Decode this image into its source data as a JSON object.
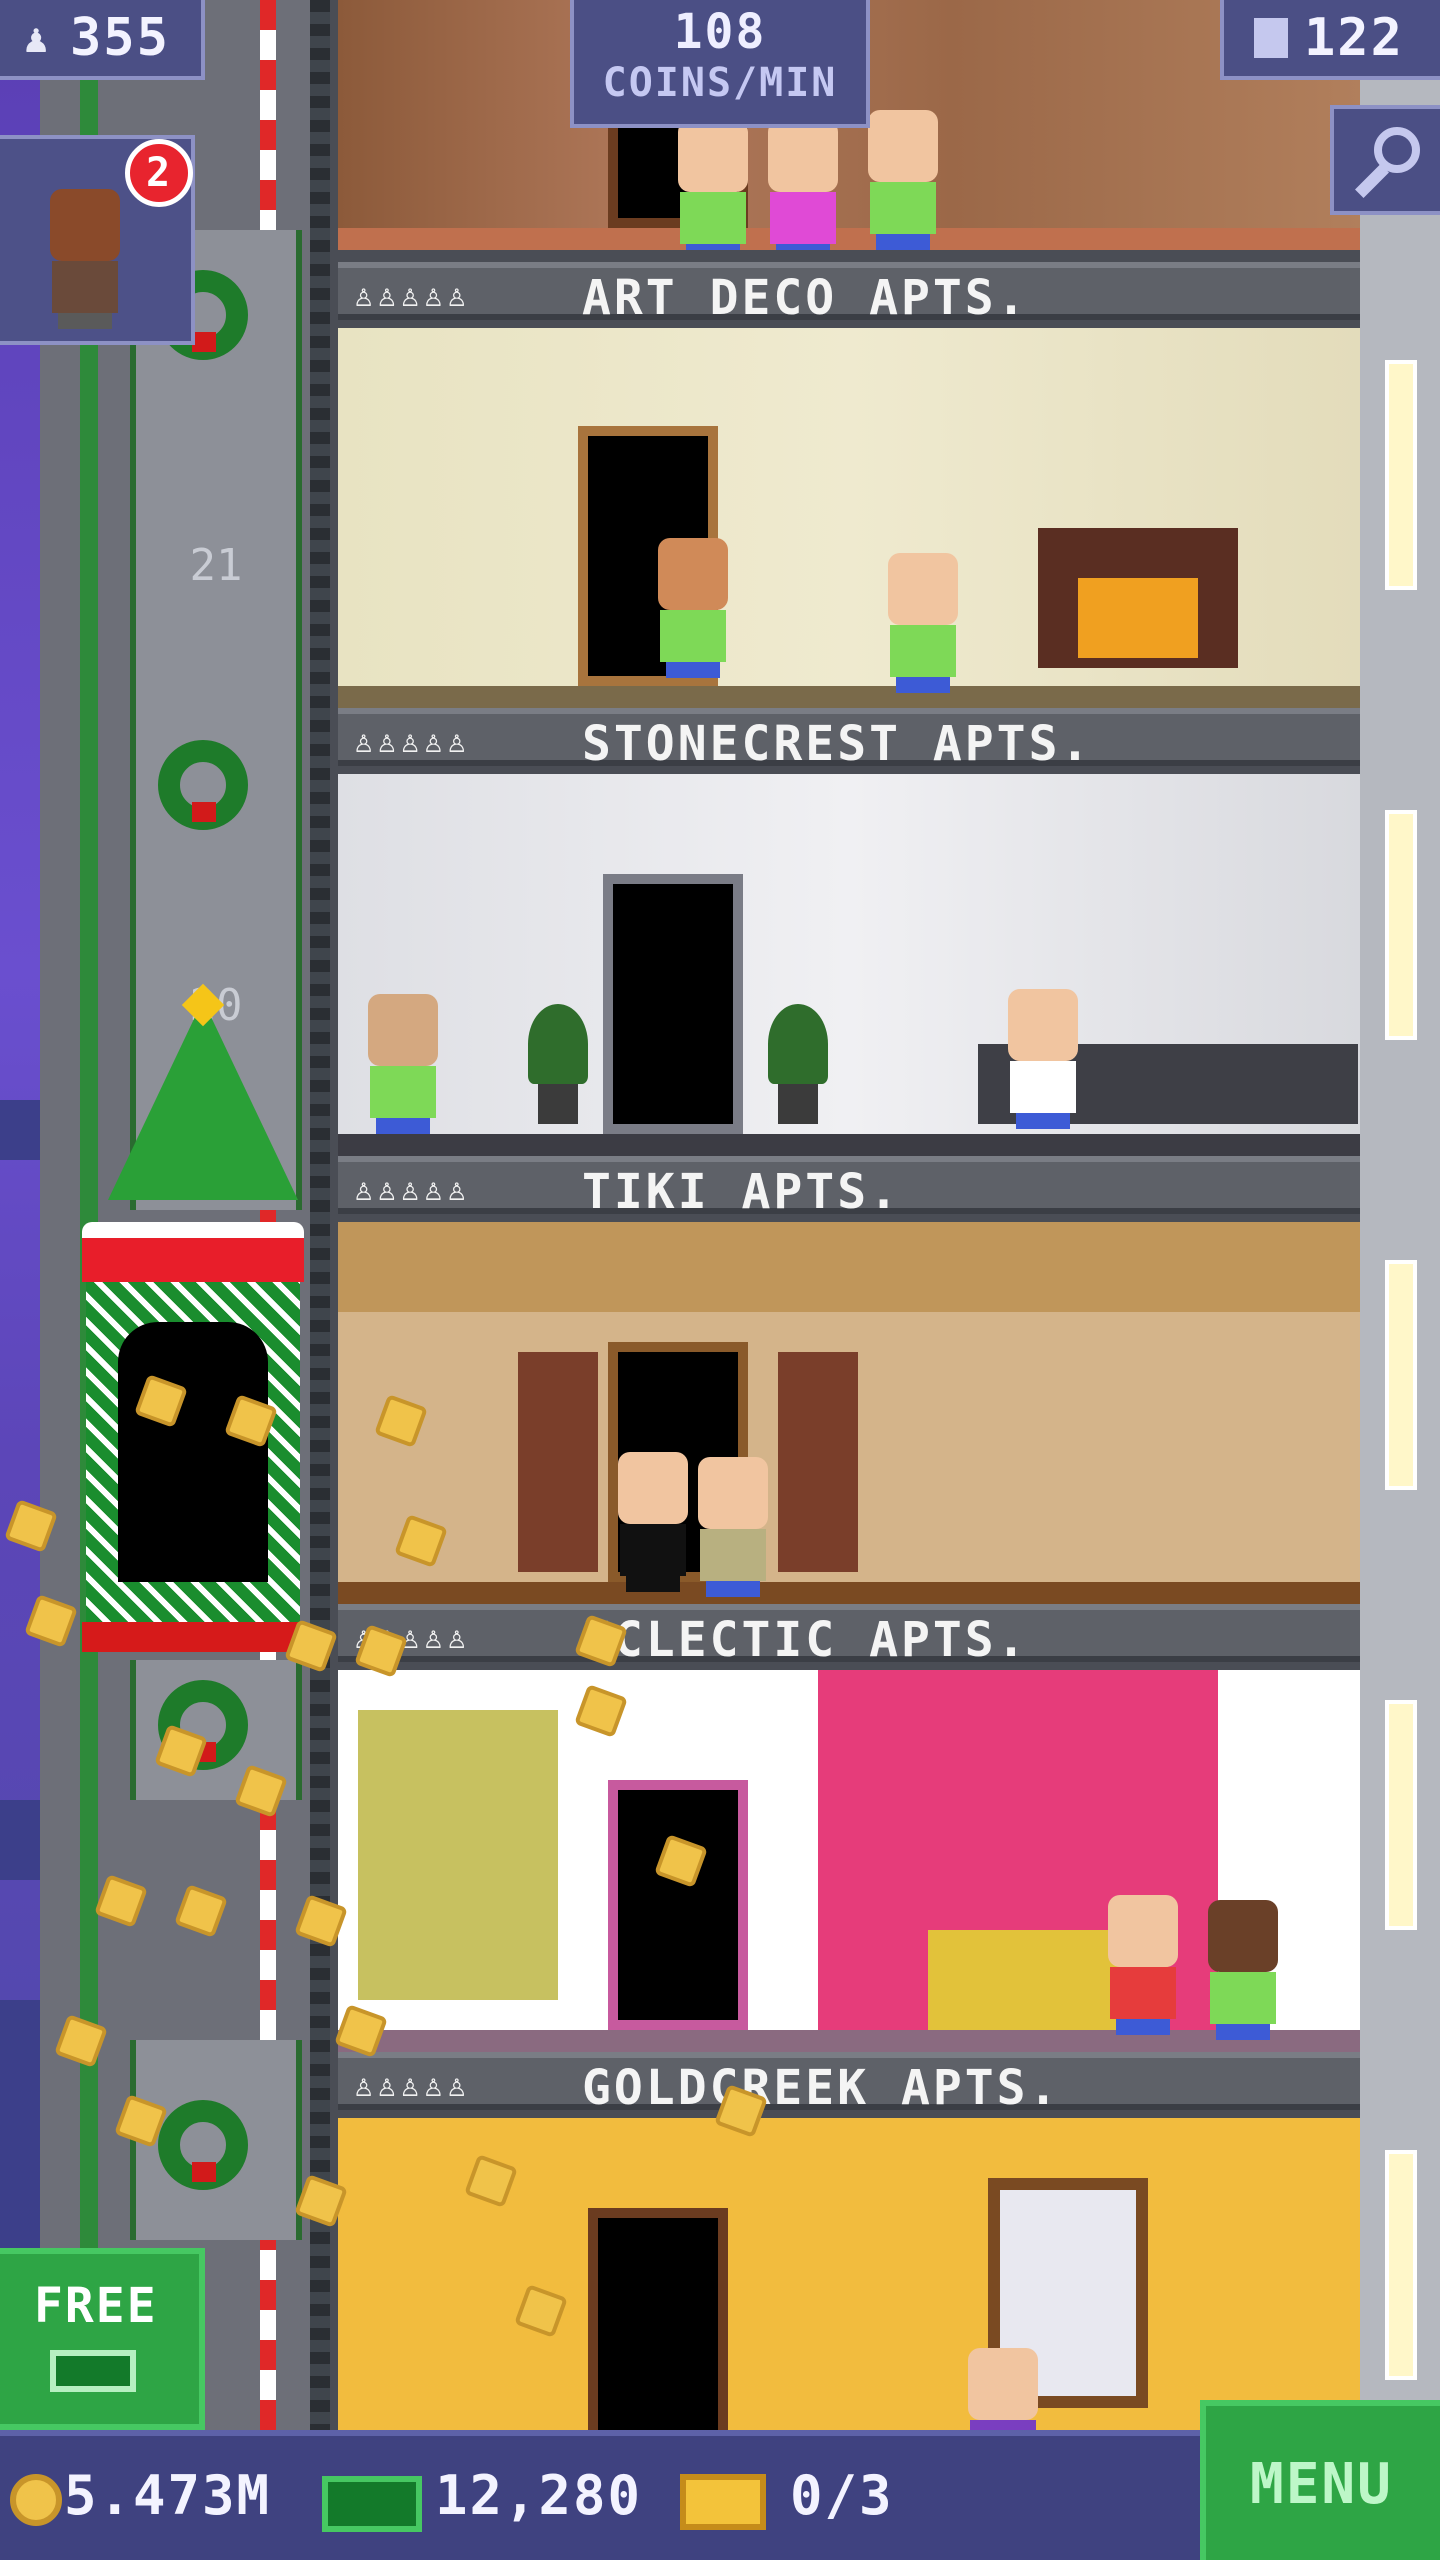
{
  "hud": {
    "population": "355",
    "coins_per_min_value": "108",
    "coins_per_min_label": "COINS/MIN",
    "floors": "122",
    "visitor_badge": "2"
  },
  "elevator_shaft": {
    "floor_numbers": [
      "21",
      "20"
    ]
  },
  "floors": [
    {
      "label": "ART DECO APTS.",
      "residents": "♙♙♙♙♙"
    },
    {
      "label": "STONECREST APTS.",
      "residents": "♙♙♙♙♙"
    },
    {
      "label": "TIKI APTS.",
      "residents": "♙♙♙♙♙"
    },
    {
      "label": "ECLECTIC APTS.",
      "residents": "♙♙♙♙♙"
    },
    {
      "label": "GOLDCREEK APTS.",
      "residents": "♙♙♙♙♙"
    }
  ],
  "buttons": {
    "free_label": "FREE",
    "menu_label": "MENU"
  },
  "bottom_bar": {
    "coins": "5.473M",
    "tower_bux": "12,280",
    "vip": "0/3"
  },
  "icons": {
    "population": "person-icon",
    "floors": "building-icon",
    "search": "magnifier-icon",
    "coin": "coin-icon",
    "bux": "bux-icon",
    "vip": "ticket-icon"
  },
  "colors": {
    "hud_bg": "#4b4f85",
    "button_green": "#2ea545",
    "badge_red": "#e8242e"
  }
}
